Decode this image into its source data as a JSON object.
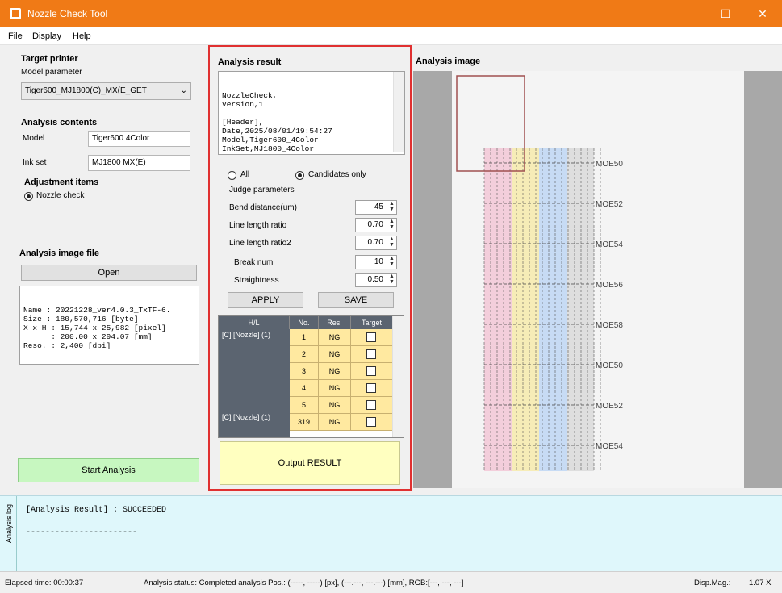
{
  "window": {
    "title": "Nozzle Check Tool",
    "minimize": "—",
    "maximize": "☐",
    "close": "✕",
    "icon": "app-icon"
  },
  "menu": [
    "File",
    "Display",
    "Help"
  ],
  "left": {
    "target_printer": "Target printer",
    "model_parameter_label": "Model parameter",
    "model_parameter_value": "Tiger600_MJ1800(C)_MX(E_GET",
    "analysis_contents": "Analysis contents",
    "model_label": "Model",
    "model_value": "Tiger600 4Color",
    "ink_set_label": "Ink set",
    "ink_set_value": "MJ1800 MX(E)",
    "adjustment_items": "Adjustment items",
    "nozzle_check": "Nozzle check",
    "analysis_image_file": "Analysis image file",
    "open": "Open",
    "file_info": "Name : 20221228_ver4.0.3_TxTF-6.\nSize : 180,570,716 [byte]\nX x H : 15,744 x 25,982 [pixel]\n      : 200.00 x 294.07 [mm]\nReso. : 2,400 [dpi]",
    "start_analysis": "Start  Analysis"
  },
  "middle": {
    "analysis_result": "Analysis result",
    "result_text": "NozzleCheck,\nVersion,1\n\n[Header],\nDate,2025/08/01/19:54:27\nModel,Tiger600_4Color\nInkSet,MJ1800_4Color",
    "all_label": "All",
    "candidates_only_label": "Candidates only",
    "judge_parameters": "Judge parameters",
    "params": [
      {
        "label": "Bend distance(um)",
        "value": "45"
      },
      {
        "label": "Line length ratio",
        "value": "0.70"
      },
      {
        "label": "Line length ratio2",
        "value": "0.70"
      },
      {
        "label": "Break num",
        "value": "10"
      },
      {
        "label": "Straightness",
        "value": "0.50"
      }
    ],
    "apply": "APPLY",
    "save": "SAVE",
    "grid_headers": [
      "H/L",
      "No.",
      "Res.",
      "Target"
    ],
    "group_top": "[C] [Nozzle] (1)",
    "group_bottom": "[C] [Nozzle] (1)",
    "grid_rows": [
      {
        "no": "1",
        "res": "NG"
      },
      {
        "no": "2",
        "res": "NG"
      },
      {
        "no": "3",
        "res": "NG"
      },
      {
        "no": "4",
        "res": "NG"
      },
      {
        "no": "5",
        "res": "NG"
      },
      {
        "no": "319",
        "res": "NG"
      }
    ],
    "output_result": "Output RESULT"
  },
  "image": {
    "label": "Analysis image",
    "row_labels": [
      "MOE50",
      "MOE52",
      "MOE54",
      "MOE56",
      "MOE58",
      "MOE50",
      "MOE52",
      "MOE54"
    ],
    "stripe_colors": [
      "#f3c4d4",
      "#f6eaa8",
      "#bcd4f4",
      "#d8d8d8"
    ]
  },
  "log": {
    "tab_label": "Analysis log",
    "line1": "[Analysis Result] : SUCCEEDED",
    "line2": "-----------------------"
  },
  "status": {
    "elapsed": "Elapsed time: 00:00:37",
    "analysis_status": "Analysis status: Completed analysis  Pos.: (-----, -----) [px],  (---.---, ---.---) [mm], RGB:[---, ---, ---]",
    "disp_mag_label": "Disp.Mag.:",
    "disp_mag_value": "1.07 X"
  },
  "colors": {
    "title_bar": "#f07a16",
    "start_button": "#c7f7c0",
    "output_button": "#ffffc0",
    "log_bg": "#dff7fb",
    "highlight_border": "#e03030"
  }
}
